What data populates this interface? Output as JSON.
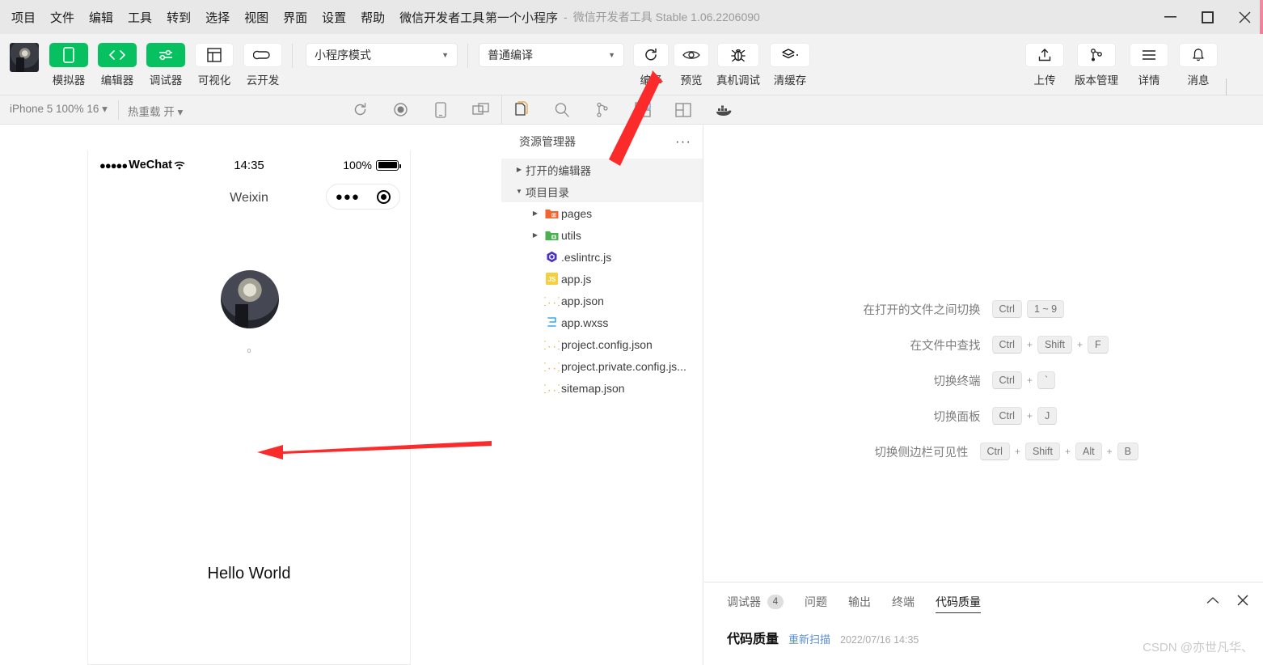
{
  "titlebar": {
    "menu": [
      "项目",
      "文件",
      "编辑",
      "工具",
      "转到",
      "选择",
      "视图",
      "界面",
      "设置",
      "帮助",
      "微信开发者工具"
    ],
    "project_name": "第一个小程序",
    "dash": "-",
    "app_name": "微信开发者工具 Stable 1.06.2206090",
    "window_controls": [
      "minimize-icon",
      "maximize-icon",
      "close-icon"
    ]
  },
  "toolbar": {
    "avatar_name": "user-avatar",
    "buttons": [
      {
        "label": "模拟器",
        "icon": "phone-icon",
        "style": "green"
      },
      {
        "label": "编辑器",
        "icon": "code-icon",
        "style": "green"
      },
      {
        "label": "调试器",
        "icon": "sliders-icon",
        "style": "green"
      },
      {
        "label": "可视化",
        "icon": "layout-icon",
        "style": "white"
      },
      {
        "label": "云开发",
        "icon": "cloud-icon",
        "style": "white"
      }
    ],
    "mode_select": "小程序模式",
    "compile_select": "普通编译",
    "actions": [
      {
        "label": "编译",
        "icon": "refresh-icon"
      },
      {
        "label": "预览",
        "icon": "eye-icon"
      },
      {
        "label": "真机调试",
        "icon": "bug-icon"
      },
      {
        "label": "清缓存",
        "icon": "layers-icon"
      }
    ],
    "right_actions": [
      {
        "label": "上传",
        "icon": "upload-icon"
      },
      {
        "label": "版本管理",
        "icon": "branch-icon"
      },
      {
        "label": "详情",
        "icon": "menu-icon"
      },
      {
        "label": "消息",
        "icon": "bell-icon"
      }
    ]
  },
  "subbar": {
    "device_select": "iPhone 5 100% 16",
    "hot_reload": "热重载 开",
    "sim_icons": [
      "refresh-icon",
      "record-icon",
      "device-icon",
      "window-icon"
    ],
    "editor_icons": [
      "files-icon",
      "search-icon",
      "source-control-icon",
      "extensions-icon",
      "layout-split-icon",
      "docker-icon"
    ]
  },
  "simulator": {
    "carrier": "WeChat",
    "signal_dots": "●●●●●",
    "wifi_icon": "wifi-icon",
    "time": "14:35",
    "battery_percent": "100%",
    "battery_icon": "battery-icon",
    "nav_title": "Weixin",
    "capsule_dots": "●●●",
    "capsule_icon": "target-icon",
    "avatar_name": "profile-avatar",
    "tiny_text": "o",
    "hello_text": "Hello World"
  },
  "explorer": {
    "title": "资源管理器",
    "more_icon": "ellipsis-icon",
    "sections": [
      {
        "label": "打开的编辑器",
        "expanded": false
      },
      {
        "label": "项目目录",
        "expanded": true
      }
    ],
    "files": [
      {
        "name": "pages",
        "type": "folder",
        "icon": "folder-pages-icon",
        "indent": 1,
        "expandable": true
      },
      {
        "name": "utils",
        "type": "folder",
        "icon": "folder-utils-icon",
        "indent": 1,
        "expandable": true
      },
      {
        "name": ".eslintrc.js",
        "type": "file",
        "icon": "eslint-icon",
        "indent": 2,
        "expandable": false
      },
      {
        "name": "app.js",
        "type": "file",
        "icon": "js-icon",
        "indent": 2,
        "expandable": false
      },
      {
        "name": "app.json",
        "type": "file",
        "icon": "json-icon",
        "indent": 2,
        "expandable": false
      },
      {
        "name": "app.wxss",
        "type": "file",
        "icon": "wxss-icon",
        "indent": 2,
        "expandable": false
      },
      {
        "name": "project.config.json",
        "type": "file",
        "icon": "json-icon",
        "indent": 2,
        "expandable": false
      },
      {
        "name": "project.private.config.js...",
        "type": "file",
        "icon": "json-icon",
        "indent": 2,
        "expandable": false
      },
      {
        "name": "sitemap.json",
        "type": "file",
        "icon": "json-icon",
        "indent": 2,
        "expandable": false
      }
    ]
  },
  "editor": {
    "shortcuts": [
      {
        "label": "在打开的文件之间切换",
        "keys": [
          "Ctrl",
          "1 ~ 9"
        ],
        "seps": [
          ""
        ]
      },
      {
        "label": "在文件中查找",
        "keys": [
          "Ctrl",
          "Shift",
          "F"
        ],
        "seps": [
          "+",
          "+"
        ]
      },
      {
        "label": "切换终端",
        "keys": [
          "Ctrl",
          "`"
        ],
        "seps": [
          "+"
        ]
      },
      {
        "label": "切换面板",
        "keys": [
          "Ctrl",
          "J"
        ],
        "seps": [
          "+"
        ]
      },
      {
        "label": "切换侧边栏可见性",
        "keys": [
          "Ctrl",
          "Shift",
          "Alt",
          "B"
        ],
        "seps": [
          "+",
          "+",
          "+"
        ]
      }
    ]
  },
  "panel": {
    "tabs": [
      {
        "label": "调试器",
        "badge": "4",
        "active": false
      },
      {
        "label": "问题",
        "badge": "",
        "active": false
      },
      {
        "label": "输出",
        "badge": "",
        "active": false
      },
      {
        "label": "终端",
        "badge": "",
        "active": false
      },
      {
        "label": "代码质量",
        "badge": "",
        "active": true
      }
    ],
    "collapse_icon": "chevron-up-icon",
    "close_icon": "close-icon",
    "body_title": "代码质量",
    "body_link": "重新扫描",
    "body_time": "2022/07/16 14:35"
  },
  "annotations": {
    "arrow_compile": "red-arrow-pointing-to-compile",
    "arrow_simulator": "red-arrow-pointing-to-simulator"
  },
  "watermark": "CSDN @亦世凡华、"
}
